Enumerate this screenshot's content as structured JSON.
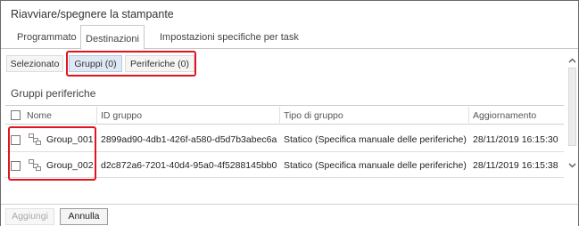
{
  "window": {
    "title": "Riavviare/spegnere la stampante"
  },
  "tabs": [
    {
      "label": "Programmato",
      "active": false
    },
    {
      "label": "Destinazioni",
      "active": true
    },
    {
      "label": "Impostazioni specifiche per task",
      "active": false
    }
  ],
  "subtabs": [
    {
      "label": "Selezionato"
    },
    {
      "label": "Gruppi (0)"
    },
    {
      "label": "Periferiche (0)"
    }
  ],
  "section": {
    "title": "Gruppi periferiche"
  },
  "table": {
    "columns": [
      "Nome",
      "ID gruppo",
      "Tipo di gruppo",
      "Aggiornamento"
    ],
    "rows": [
      {
        "name": "Group_001",
        "id": "2899ad90-4db1-426f-a580-d5d7b3abec6a",
        "type": "Statico (Specifica manuale delle periferiche)",
        "updated": "28/11/2019 16:15:30",
        "checked": false
      },
      {
        "name": "Group_002",
        "id": "d2c872a6-7201-40d4-95a0-4f5288145bb0",
        "type": "Statico (Specifica manuale delle periferiche)",
        "updated": "28/11/2019 16:15:38",
        "checked": false
      }
    ]
  },
  "footer": {
    "add_label": "Aggiungi",
    "cancel_label": "Annulla"
  },
  "colors": {
    "highlight": "#e0141f",
    "selected_tab_bg": "#dfe9f5"
  },
  "icons": {
    "group": "group-icon",
    "scroll_up": "chevron-up-icon",
    "scroll_down": "chevron-down-icon"
  }
}
